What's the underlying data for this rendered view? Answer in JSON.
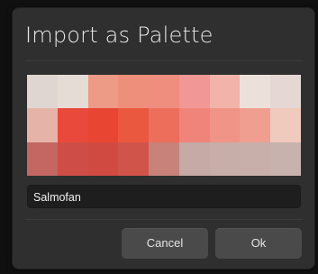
{
  "dialog": {
    "title": "Import as Palette",
    "palette_name": "Salmofan",
    "buttons": {
      "cancel": "Cancel",
      "ok": "Ok"
    }
  },
  "palette": {
    "columns": 9,
    "rows": 3,
    "colors": [
      [
        "#dfd6d2",
        "#e5dcd6",
        "#ed9a86",
        "#ee8f7b",
        "#ef8e7f",
        "#f19896",
        "#f2b3ab",
        "#ece0da",
        "#e5d8d4"
      ],
      [
        "#e6b3a9",
        "#e8493a",
        "#e84632",
        "#e9583f",
        "#ed6e5b",
        "#f0837a",
        "#f19488",
        "#f09e90",
        "#f0cbbd"
      ],
      [
        "#c46661",
        "#ce4e47",
        "#d14a42",
        "#d0544a",
        "#c9827a",
        "#c5aaa6",
        "#c7aea9",
        "#c9afaa",
        "#c8b2ae"
      ]
    ]
  }
}
